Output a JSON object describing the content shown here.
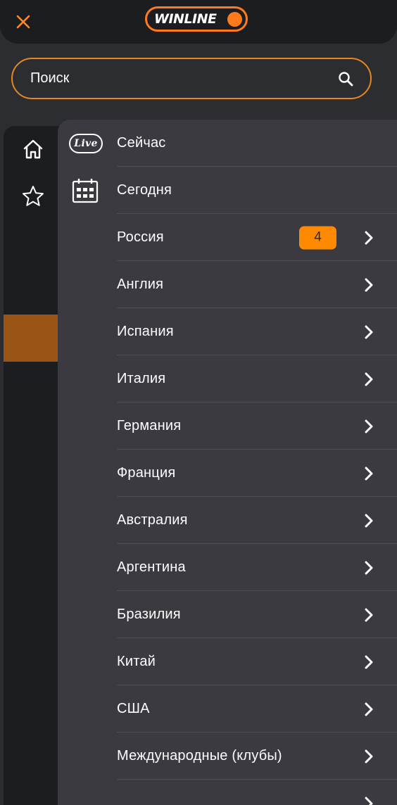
{
  "header": {
    "close_icon": "close-icon",
    "logo_text": "WINLINE",
    "accent_color": "#ff7a1a"
  },
  "search": {
    "placeholder": "Поиск",
    "icon": "search-icon"
  },
  "rail": {
    "items": [
      {
        "icon": "home-icon"
      },
      {
        "icon": "star-icon"
      }
    ],
    "highlight_color": "#9a5516"
  },
  "menu": {
    "live_badge": "Live",
    "items": [
      {
        "label": "Сейчас",
        "icon": "live-icon"
      },
      {
        "label": "Сегодня",
        "icon": "calendar-icon"
      },
      {
        "label": "Россия",
        "badge": "4",
        "chevron": true
      },
      {
        "label": "Англия",
        "chevron": true
      },
      {
        "label": "Испания",
        "chevron": true
      },
      {
        "label": "Италия",
        "chevron": true
      },
      {
        "label": "Германия",
        "chevron": true
      },
      {
        "label": "Франция",
        "chevron": true
      },
      {
        "label": "Австралия",
        "chevron": true
      },
      {
        "label": "Аргентина",
        "chevron": true
      },
      {
        "label": "Бразилия",
        "chevron": true
      },
      {
        "label": "Китай",
        "chevron": true
      },
      {
        "label": "США",
        "chevron": true
      },
      {
        "label": "Международные (клубы)",
        "chevron": true
      }
    ],
    "badge_color": "#ff8a00"
  }
}
